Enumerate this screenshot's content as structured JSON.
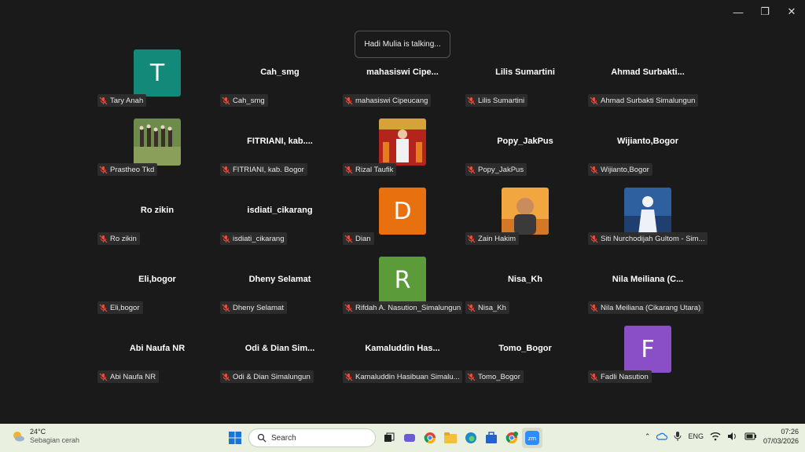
{
  "window": {
    "minimize": "—",
    "restore": "❐",
    "close": "✕"
  },
  "talking": "Hadi Mulia is talking...",
  "participants": [
    {
      "label": "Tary Anah",
      "display": "T",
      "type": "letter",
      "color": "#13897a"
    },
    {
      "label": "Cah_smg",
      "display": "Cah_smg",
      "type": "name"
    },
    {
      "label": "mahasiswi Cipeucang",
      "display": "mahasiswi  Cipe...",
      "type": "name"
    },
    {
      "label": "Lilis Sumartini",
      "display": "Lilis Sumartini",
      "type": "name"
    },
    {
      "label": "Ahmad Surbakti Simalungun",
      "display": "Ahmad  Surbakti...",
      "type": "name"
    },
    {
      "label": "Prastheo Tkd",
      "display": "",
      "type": "photo",
      "photo": "group"
    },
    {
      "label": "FITRIANI,  kab. Bogor",
      "display": "FITRIANI,   kab....",
      "type": "name"
    },
    {
      "label": "Rizal Taufik",
      "display": "",
      "type": "photo",
      "photo": "red"
    },
    {
      "label": "Popy_JakPus",
      "display": "Popy_JakPus",
      "type": "name"
    },
    {
      "label": "Wijianto,Bogor",
      "display": "Wijianto,Bogor",
      "type": "name"
    },
    {
      "label": "Ro zikin",
      "display": "Ro zikin",
      "type": "name"
    },
    {
      "label": "isdiati_cikarang",
      "display": "isdiati_cikarang",
      "type": "name"
    },
    {
      "label": "Dian",
      "display": "D",
      "type": "letter",
      "color": "#e8700f"
    },
    {
      "label": "Zain Hakim",
      "display": "",
      "type": "photo",
      "photo": "kid"
    },
    {
      "label": "Siti Nurchodijah Gultom - Sim...",
      "display": "",
      "type": "photo",
      "photo": "blue"
    },
    {
      "label": "Eli,bogor",
      "display": "Eli,bogor",
      "type": "name"
    },
    {
      "label": "Dheny Selamat",
      "display": "Dheny Selamat",
      "type": "name"
    },
    {
      "label": "Rifdah A. Nasution_Simalungun",
      "display": "R",
      "type": "letter",
      "color": "#5c9b3a"
    },
    {
      "label": "Nisa_Kh",
      "display": "Nisa_Kh",
      "type": "name"
    },
    {
      "label": "Nila Meiliana (Cikarang Utara)",
      "display": "Nila  Meiliana  (C...",
      "type": "name"
    },
    {
      "label": "Abi Naufa NR",
      "display": "Abi Naufa NR",
      "type": "name"
    },
    {
      "label": "Odi & Dian Simalungun",
      "display": "Odi  &  Dian  Sim...",
      "type": "name"
    },
    {
      "label": "Kamaluddin Hasibuan Simalu...",
      "display": "Kamaluddin   Has...",
      "type": "name"
    },
    {
      "label": "Tomo_Bogor",
      "display": "Tomo_Bogor",
      "type": "name"
    },
    {
      "label": "Fadli Nasution",
      "display": "F",
      "type": "letter",
      "color": "#8a4fc6"
    }
  ],
  "taskbar": {
    "weather_temp": "24°C",
    "weather_desc": "Sebagian cerah",
    "search_placeholder": "Search",
    "lang": "ENG",
    "time": "07:26",
    "date": "07/03/2026"
  }
}
